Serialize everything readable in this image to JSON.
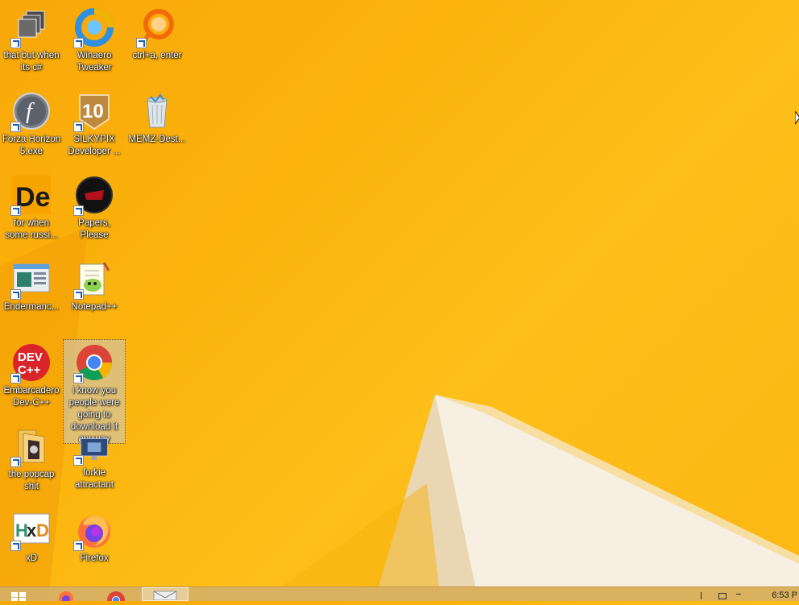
{
  "desktop": {
    "icons": [
      {
        "label": "that but when its c#",
        "icon": "stacked-windows-icon"
      },
      {
        "label": "Winaero Tweaker",
        "icon": "winaero-tweaker-icon"
      },
      {
        "label": "ctrl+a, enter",
        "icon": "orange-circle-icon"
      },
      {
        "label": "Forza Horizon 5.exe",
        "icon": "flash-player-icon"
      },
      {
        "label": "SILKYPIX Developer ...",
        "icon": "silkypix-10-icon"
      },
      {
        "label": "MEMZ-Dest...",
        "icon": "recycle-bin-icon"
      },
      {
        "label": "for when some russi...",
        "icon": "de-app-icon"
      },
      {
        "label": "Papers, Please",
        "icon": "papers-please-icon"
      },
      {
        "label": "Endermanc...",
        "icon": "window-app-icon"
      },
      {
        "label": "Notepad++",
        "icon": "notepad-plus-plus-icon"
      },
      {
        "label": "Embarcadero Dev-C++",
        "icon": "dev-cpp-icon"
      },
      {
        "label": "i know you people were going to download it anyway",
        "icon": "chrome-icon"
      },
      {
        "label": "the popcap shit",
        "icon": "popcap-folder-icon"
      },
      {
        "label": "forkie attractant",
        "icon": "monitor-robot-icon"
      },
      {
        "label": "xD",
        "icon": "hxd-icon"
      },
      {
        "label": "Firefox",
        "icon": "firefox-icon"
      }
    ]
  },
  "taskbar": {
    "items": [
      "start-icon",
      "firefox-icon",
      "chrome-icon",
      "app-icon"
    ],
    "clock": "6:53 P"
  },
  "colors": {
    "wallpaper": "#fbb40c",
    "taskbar": "#d6b066",
    "chrome_red": "#db4437",
    "chrome_green": "#0f9d58",
    "chrome_yellow": "#f4b400",
    "chrome_blue": "#4285f4"
  }
}
